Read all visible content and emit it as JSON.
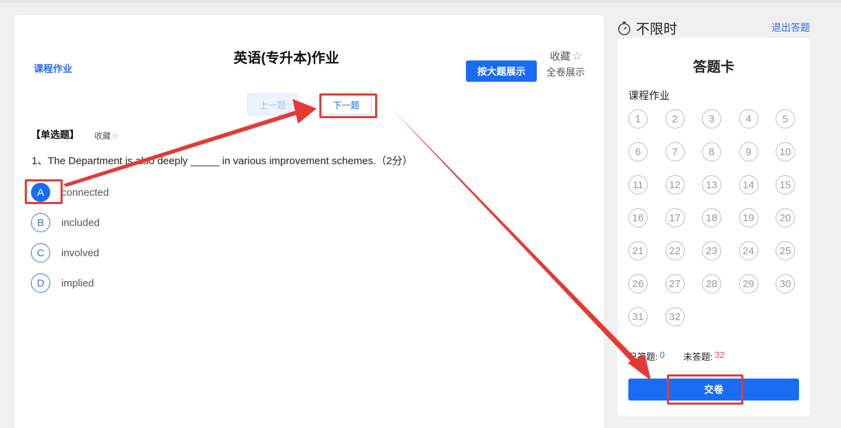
{
  "page": {
    "title": "英语(专升本)作业",
    "favorite_label": "收藏",
    "breadcrumb": "课程作业",
    "view_by_major": "按大题展示",
    "view_full": "全卷展示",
    "prev_label": "上一题",
    "next_label": "下一题"
  },
  "question": {
    "type_label": "【单选题】",
    "favorite_label": "收藏",
    "text": "1、The Department is also deeply _____ in various improvement schemes.（2分）",
    "selected": "A",
    "options": [
      {
        "letter": "A",
        "text": "connected"
      },
      {
        "letter": "B",
        "text": "included"
      },
      {
        "letter": "C",
        "text": "involved"
      },
      {
        "letter": "D",
        "text": "implied"
      }
    ]
  },
  "sidebar": {
    "timer_label": "不限时",
    "exit_label": "退出答题",
    "card_title": "答题卡",
    "section_label": "课程作业",
    "numbers": [
      "1",
      "2",
      "3",
      "4",
      "5",
      "6",
      "7",
      "8",
      "9",
      "10",
      "11",
      "12",
      "13",
      "14",
      "15",
      "16",
      "17",
      "18",
      "19",
      "20",
      "21",
      "22",
      "23",
      "24",
      "25",
      "26",
      "27",
      "28",
      "29",
      "30",
      "31",
      "32"
    ],
    "answered_label": "已答题:",
    "answered_value": "0",
    "unanswered_label": "未答题:",
    "unanswered_value": "32",
    "submit_label": "交卷"
  },
  "colors": {
    "accent": "#1a6cf5",
    "annotation": "#e53935"
  }
}
